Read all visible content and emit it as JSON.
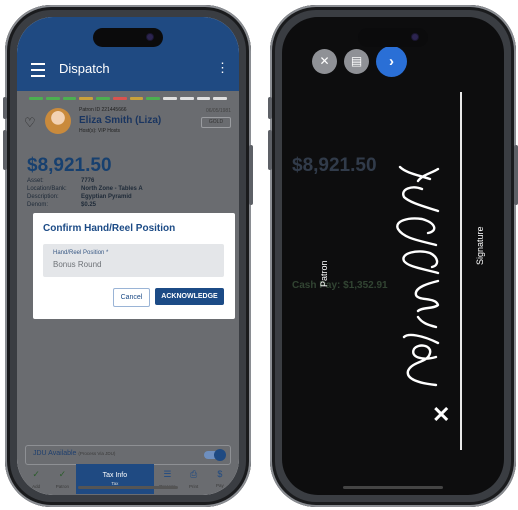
{
  "left_phone": {
    "appbar": {
      "title": "Dispatch",
      "more_icon": "⋮"
    },
    "status_colors": [
      "#4caf50",
      "#4caf50",
      "#4caf50",
      "#c9a13b",
      "#4caf50",
      "#d9534f",
      "#c9a13b",
      "#4caf50",
      "#e0e0e0",
      "#e0e0e0",
      "#e0e0e0",
      "#e0e0e0"
    ],
    "patron": {
      "id_label": "Patron ID 221445666",
      "name": "Eliza Smith (Liza)",
      "host": "Host(s): VIP Hosts",
      "date": "06/05/1981",
      "tier": "GOLD"
    },
    "amount": "$8,921.50",
    "details": [
      {
        "label": "Asset:",
        "value": "7776"
      },
      {
        "label": "Location/Bank:",
        "value": "North Zone - Tables A"
      },
      {
        "label": "Description:",
        "value": "Egyptian Pyramid"
      },
      {
        "label": "Denom:",
        "value": "$0.25"
      }
    ],
    "dialog": {
      "title": "Confirm Hand/Reel Position",
      "field_label": "Hand/Reel Position *",
      "field_value": "Bonus Round",
      "cancel": "Cancel",
      "acknowledge": "ACKNOWLEDGE"
    },
    "jdu": {
      "label": "JDU Available",
      "note": "(Process Via JDU)",
      "enabled": true
    },
    "toolbar": [
      {
        "icon": "check-circle-icon",
        "glyph": "✓",
        "label": "Add"
      },
      {
        "icon": "check-circle-icon",
        "glyph": "✓",
        "label": "Patron"
      },
      {
        "icon": "tax-info-icon",
        "text": "Tax Info",
        "label": "Tax"
      },
      {
        "icon": "sliders-icon",
        "glyph": "☰",
        "label": "Process"
      },
      {
        "icon": "print-icon",
        "glyph": "⎙",
        "label": "Print"
      },
      {
        "icon": "dollar-icon",
        "glyph": "$",
        "label": "Pay"
      }
    ]
  },
  "right_phone": {
    "buttons": [
      {
        "icon": "close-circle-icon",
        "glyph": "✕",
        "color": "#8f9196"
      },
      {
        "icon": "list-icon",
        "glyph": "▤",
        "color": "#8f9196"
      },
      {
        "icon": "next-icon",
        "glyph": "›",
        "color": "#2a6fd6"
      }
    ],
    "patron_label": "Patron",
    "signature_label": "Signature",
    "clear_mark": "✕",
    "signature_name": "Eliza Smith",
    "background_amount": "$8,921.50",
    "background_cash_pay": "Cash Pay: $1,352.91"
  }
}
